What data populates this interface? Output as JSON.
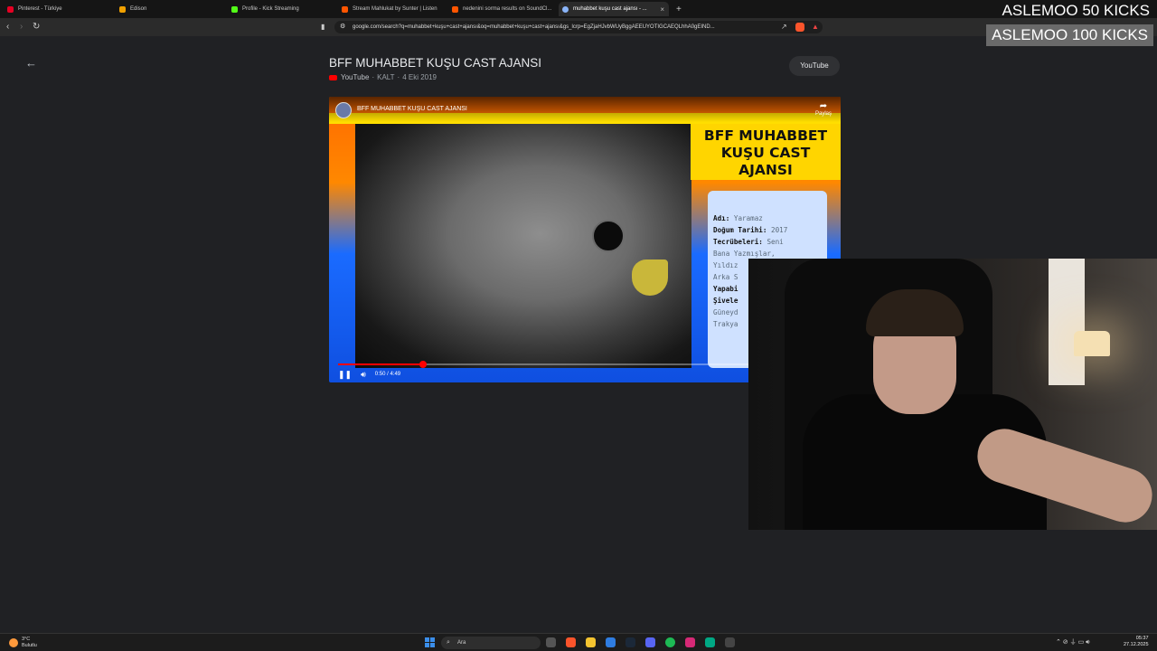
{
  "browser": {
    "tabs": [
      {
        "title": "Pinterest - Türkiye",
        "color": "#e60023"
      },
      {
        "title": "Edison",
        "color": "#f0a000"
      },
      {
        "title": "Profile - Kick Streaming",
        "color": "#53fc18"
      },
      {
        "title": "Stream Mahlukat by Sunter | Listen",
        "color": "#ff5500"
      },
      {
        "title": "nedenini sorma results on SoundCl...",
        "color": "#ff5500"
      },
      {
        "title": "muhabbet kuşu cast ajansı - ...",
        "color": "#8ab4f8",
        "active": true
      }
    ],
    "new_tab": "+",
    "url": "google.com/search?q=muhabbet+kuşu+cast+ajansı&oq=muhabbet+kuşu+cast+ajansı&gs_lcrp=EgZjaHJvbWUyBggAEEUYOTIGCAEQLhhA0gEIND..."
  },
  "page": {
    "title": "BFF MUHABBET KUŞU CAST AJANSI",
    "source": "YouTube",
    "channel": "KALT",
    "date": "4 Eki 2019",
    "separator": "·",
    "youtube_button": "YouTube"
  },
  "video": {
    "overlay_title": "BFF MUHABBET KUŞU CAST AJANSI",
    "share_label": "Paylaş",
    "heading": "BFF MUHABBET KUŞU CAST AJANSI",
    "card": {
      "name_label": "Adı:",
      "name_value": "Yaramaz",
      "birth_label": "Doğum Tarihi:",
      "birth_value": "2017",
      "exp_label": "Tecrübeleri:",
      "exp_value_1": "Seni",
      "exp_value_2": "Bana Yazmışlar,",
      "exp_value_3": "Yıldız",
      "exp_value_4": "Arka S",
      "can_label_1": "Yapabi",
      "can_label_2": "Şivele",
      "can_value_1": "Güneyd",
      "can_value_2": "Trakya"
    },
    "time": "0:50 / 4:49",
    "progress_fraction": 0.172
  },
  "overlay": {
    "kicks_50": "ASLEMOO  50 KICKS",
    "kicks_100": "ASLEMOO  100 KICKS"
  },
  "taskbar": {
    "temp": "3°C",
    "weather": "Bulutlu",
    "search": "Ara",
    "time": "05:37",
    "date": "27.12.2025"
  }
}
